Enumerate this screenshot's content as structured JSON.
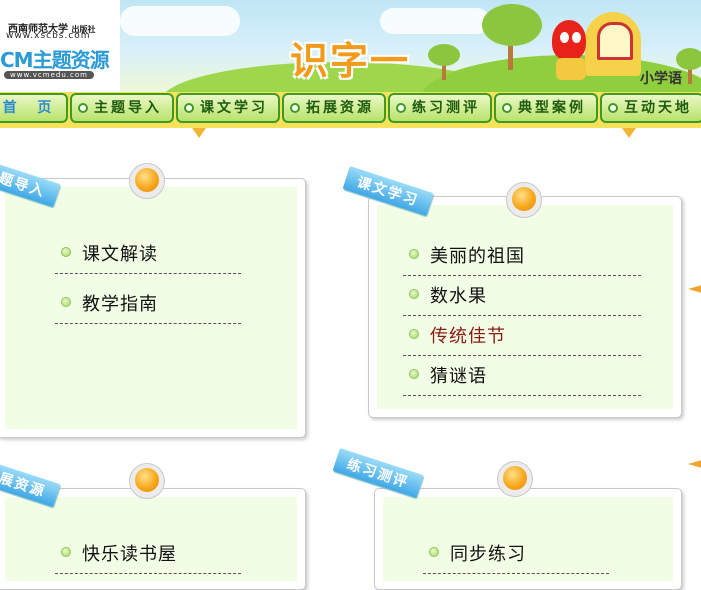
{
  "header": {
    "publisher_name": "西南师范大学",
    "publisher_suffix": "出版社",
    "publisher_url": "www.xscbs.com",
    "brand_name": "CM主题资源",
    "brand_url": "www.vcmedu.com",
    "page_title": "识字一",
    "grade_label": "小学语"
  },
  "nav": {
    "items": [
      {
        "label": "首 页"
      },
      {
        "label": "主题导入"
      },
      {
        "label": "课文学习"
      },
      {
        "label": "拓展资源"
      },
      {
        "label": "练习测评"
      },
      {
        "label": "典型案例"
      },
      {
        "label": "互动天地"
      }
    ]
  },
  "panels": {
    "intro": {
      "title": "题导入",
      "links": [
        "课文解读",
        "教学指南"
      ]
    },
    "study": {
      "title": "课文学习",
      "links": [
        "美丽的祖国",
        "数水果",
        "传统佳节",
        "猜谜语"
      ]
    },
    "extend": {
      "title": "展资源",
      "links": [
        "快乐读书屋"
      ]
    },
    "practice": {
      "title": "练习测评",
      "links": [
        "同步练习"
      ]
    }
  },
  "colors": {
    "nav_border": "#3f9a23",
    "nav_bar": "#f7e25c",
    "ribbon": "#3fa7e6",
    "active_link": "#8a1a12",
    "panel_inner": "#f2fde6"
  }
}
